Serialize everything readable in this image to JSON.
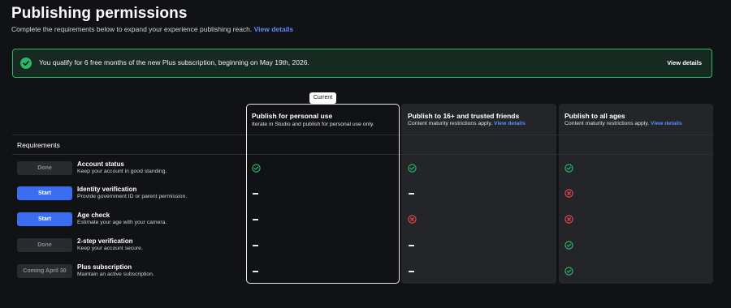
{
  "page": {
    "title": "Publishing permissions",
    "subtitle": "Complete the requirements below to expand your experience publishing reach.",
    "subtitle_link": "View details"
  },
  "banner": {
    "text": "You qualify for 6 free months of the new Plus subscription, beginning on May 19th, 2026.",
    "button": "View details",
    "icon": "check-circle-icon",
    "accent": "#2bb56d"
  },
  "columns": [
    {
      "title": "Publish for personal use",
      "desc": "Iterate in Studio and publish for personal use only.",
      "link": "",
      "badge": "Current"
    },
    {
      "title": "Publish to 16+ and trusted friends",
      "desc": "Content maturity restrictions apply.",
      "link": "View details"
    },
    {
      "title": "Publish to all ages",
      "desc": "Content maturity restrictions apply.",
      "link": "View details"
    }
  ],
  "requirements_label": "Requirements",
  "rows": [
    {
      "button": "Done",
      "state": "done",
      "title": "Account status",
      "desc": "Keep your account in good standing.",
      "status": [
        "check",
        "check",
        "check"
      ]
    },
    {
      "button": "Start",
      "state": "start",
      "title": "Identity verification",
      "desc": "Provide government ID or parent permission.",
      "status": [
        "dash",
        "dash",
        "x"
      ]
    },
    {
      "button": "Start",
      "state": "start",
      "title": "Age check",
      "desc": "Estimate your age with your camera.",
      "status": [
        "dash",
        "x",
        "x"
      ]
    },
    {
      "button": "Done",
      "state": "done",
      "title": "2-step verification",
      "desc": "Keep your account secure.",
      "status": [
        "dash",
        "dash",
        "check"
      ]
    },
    {
      "button": "Coming April 30",
      "state": "coming",
      "title": "Plus subscription",
      "desc": "Maintain an active subscription.",
      "status": [
        "dash",
        "dash",
        "check"
      ]
    }
  ],
  "colors": {
    "check": "#2bb56d",
    "cross": "#e5484d",
    "start": "#3a6df0"
  }
}
